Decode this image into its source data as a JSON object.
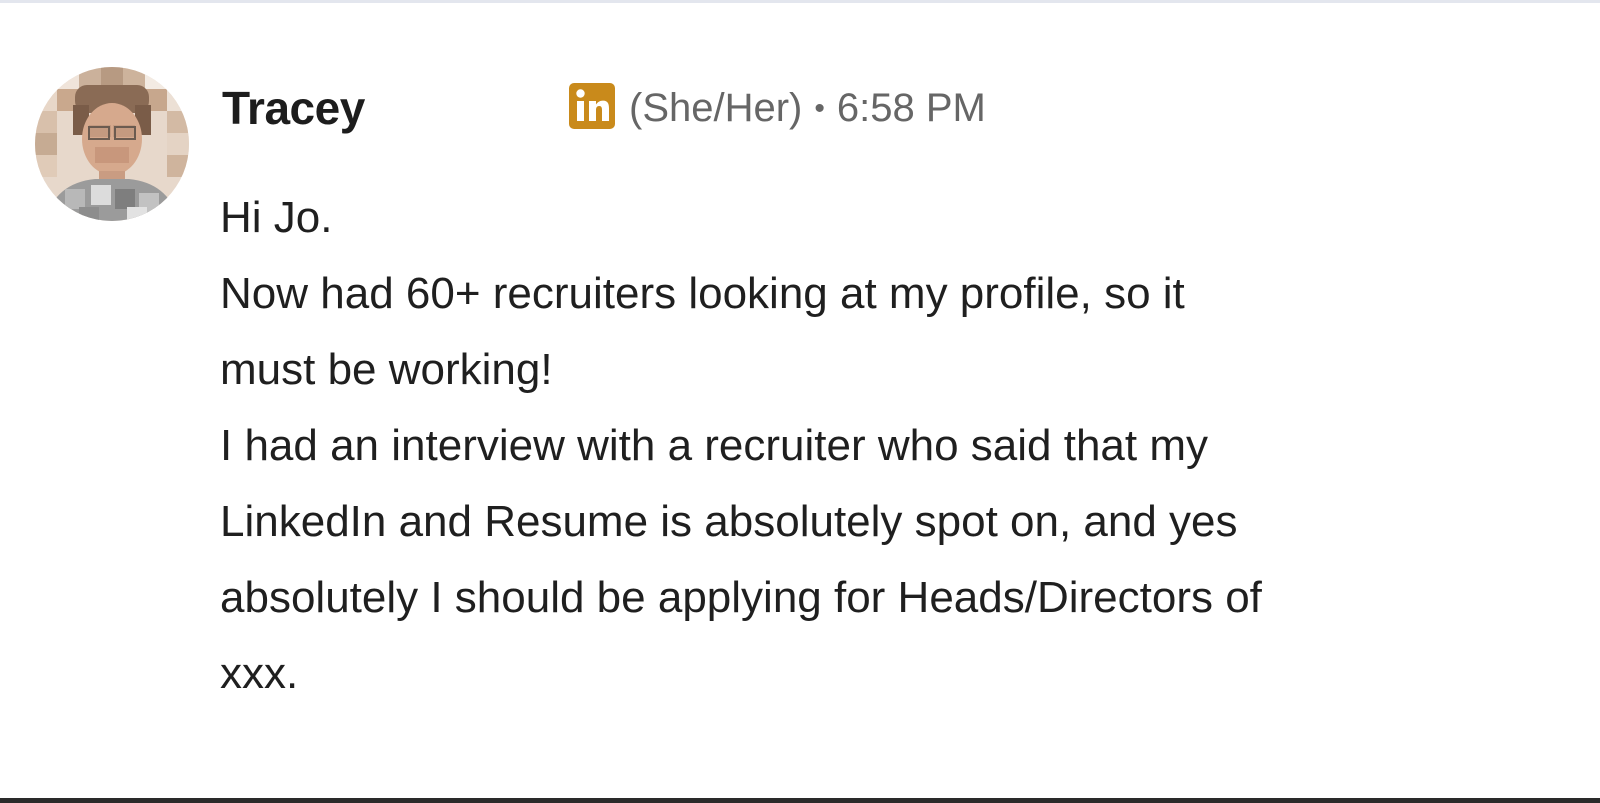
{
  "message": {
    "sender": {
      "name": "Tracey",
      "avatar_icon": "profile-photo",
      "badge_icon": "linkedin-icon",
      "badge_color": "#c98a1b",
      "pronouns": "(She/Her)",
      "separator": "•",
      "time": "6:58 PM"
    },
    "body_lines": [
      "Hi Jo.",
      "Now had 60+ recruiters looking at my profile, so it",
      "must be working!",
      "I had an interview with a recruiter who said that my",
      "LinkedIn and Resume is absolutely spot on, and yes",
      "absolutely I should be applying for Heads/Directors of",
      "xxx."
    ]
  }
}
